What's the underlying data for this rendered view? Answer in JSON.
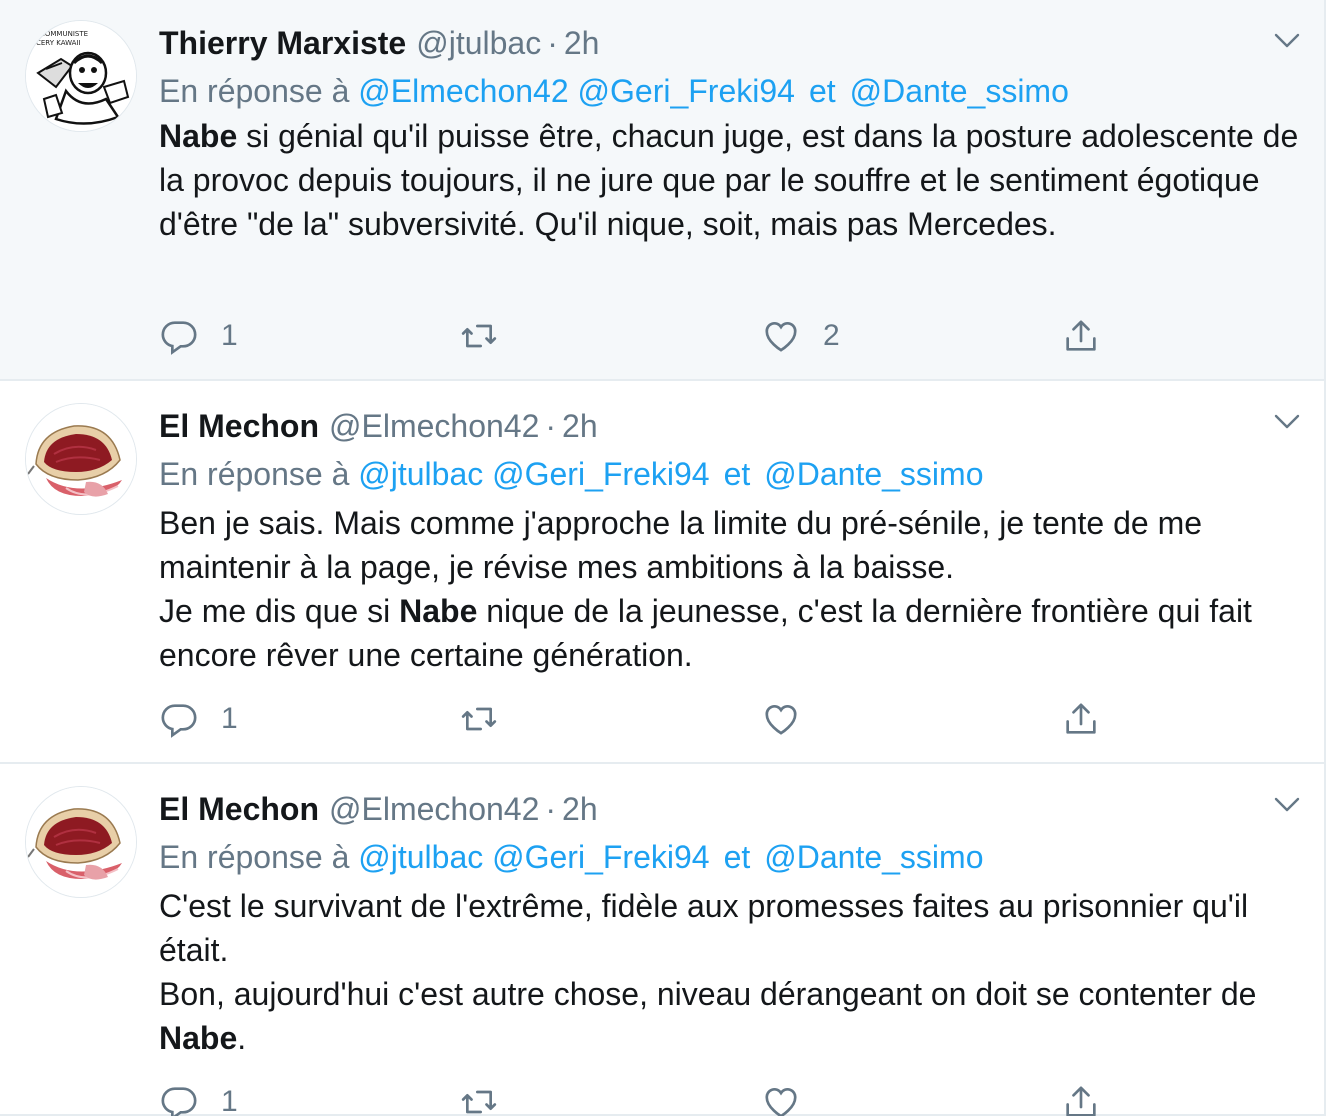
{
  "tweets": [
    {
      "name": "Thierry Marxiste",
      "handle": "@jtulbac",
      "dot": "·",
      "time": "2h",
      "reply_prefix": "En réponse à",
      "mentions": [
        "@Elmechon42",
        "@Geri_Freki94"
      ],
      "and": "et",
      "last_mention": "@Dante_ssimo",
      "body": [
        {
          "bold": "Nabe",
          "text": " si génial qu'il puisse être, chacun juge, est dans la posture adolescente de la provoc depuis toujours, il ne jure que par le souffre et le sentiment égotique d'être \"de la\" subversivité. Qu'il nique, soit, mais pas Mercedes."
        }
      ],
      "reply_count": "1",
      "retweet_count": "",
      "like_count": "2",
      "avatar_caption": [
        "COMMUNISTE",
        "CERY KAWAII"
      ]
    },
    {
      "name": "El Mechon",
      "handle": "@Elmechon42",
      "dot": "·",
      "time": "2h",
      "reply_prefix": "En réponse à",
      "mentions": [
        "@jtulbac",
        "@Geri_Freki94"
      ],
      "and": "et",
      "last_mention": "@Dante_ssimo",
      "body_lines": [
        "Ben je sais. Mais comme j'approche la limite du pré-sénile, je tente de me maintenir à la page, je révise mes ambitions à la baisse.",
        "Je me dis que si ",
        "Nabe",
        " nique de la jeunesse, c'est la dernière frontière qui fait encore rêver une certaine génération."
      ],
      "reply_count": "1",
      "retweet_count": "",
      "like_count": ""
    },
    {
      "name": "El Mechon",
      "handle": "@Elmechon42",
      "dot": "·",
      "time": "2h",
      "reply_prefix": "En réponse à",
      "mentions": [
        "@jtulbac",
        "@Geri_Freki94"
      ],
      "and": "et",
      "last_mention": "@Dante_ssimo",
      "body_lines": [
        "C'est le survivant de l'extrême, fidèle aux promesses faites au prisonnier qu'il était.",
        "Bon, aujourd'hui c'est autre chose, niveau dérangeant on doit se contenter de ",
        "Nabe",
        "."
      ],
      "reply_count": "1",
      "retweet_count": "",
      "like_count": ""
    }
  ],
  "colors": {
    "link": "#1da1f2",
    "secondary": "#657786",
    "text": "#14171a",
    "highlight_bg": "#f5f8fa",
    "border": "#e6ecf0"
  },
  "icons": [
    "reply-icon",
    "retweet-icon",
    "like-icon",
    "share-icon",
    "chevron-down-icon"
  ]
}
